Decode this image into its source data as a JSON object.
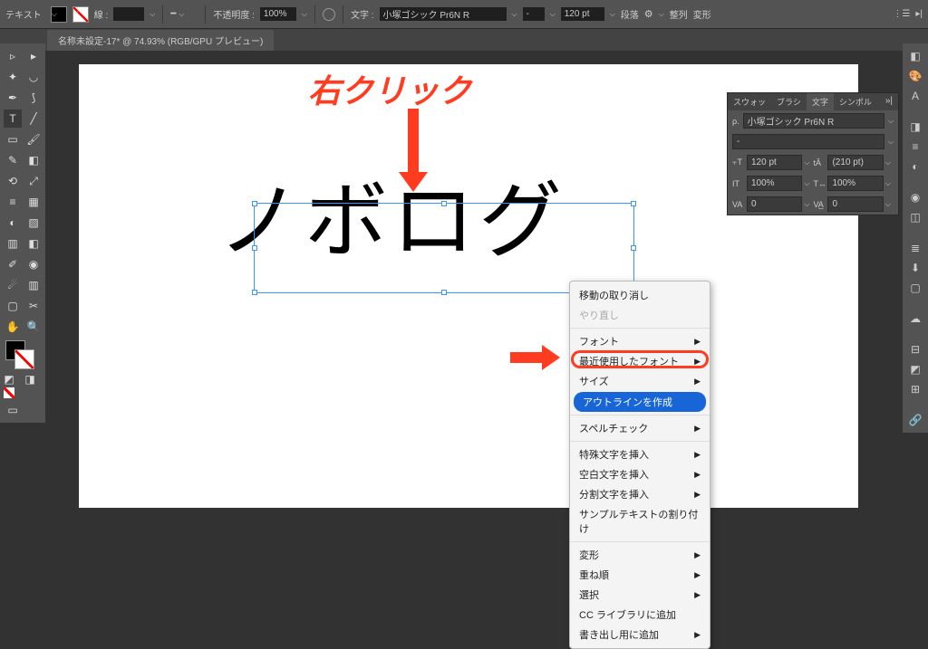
{
  "topbar": {
    "tool_label": "テキスト",
    "stroke_label": "線 :",
    "stroke_width": "",
    "opacity_label": "不透明度 :",
    "opacity_value": "100%",
    "char_label": "文字 :",
    "font_name": "小塚ゴシック Pr6N R",
    "font_style": "-",
    "font_size": "120 pt",
    "para_label": "段落",
    "align_label": "整列",
    "transform_label": "変形"
  },
  "document": {
    "tab_title": "名称未設定-17* @ 74.93% (RGB/GPU プレビュー)"
  },
  "canvas": {
    "text_content": "ノボログ"
  },
  "annotation": {
    "title": "右クリック"
  },
  "char_panel": {
    "tabs": [
      "スウォッ",
      "ブラシ",
      "文字",
      "シンボル"
    ],
    "font": "小塚ゴシック Pr6N R",
    "style": "-",
    "size": "120 pt",
    "leading": "(210 pt)",
    "hscale": "100%",
    "vscale": "100%",
    "tracking": "0",
    "kerning": "0"
  },
  "context_menu": {
    "items": [
      {
        "label": "移動の取り消し",
        "disabled": false,
        "sub": false
      },
      {
        "label": "やり直し",
        "disabled": true,
        "sub": false
      },
      {
        "sep": true
      },
      {
        "label": "フォント",
        "sub": true
      },
      {
        "label": "最近使用したフォント",
        "sub": true
      },
      {
        "label": "サイズ",
        "sub": true
      },
      {
        "label": "アウトラインを作成",
        "highlight": true
      },
      {
        "sep": true
      },
      {
        "label": "スペルチェック",
        "sub": true
      },
      {
        "sep": true
      },
      {
        "label": "特殊文字を挿入",
        "sub": true
      },
      {
        "label": "空白文字を挿入",
        "sub": true
      },
      {
        "label": "分割文字を挿入",
        "sub": true
      },
      {
        "label": "サンプルテキストの割り付け"
      },
      {
        "sep": true
      },
      {
        "label": "変形",
        "sub": true
      },
      {
        "label": "重ね順",
        "sub": true
      },
      {
        "label": "選択",
        "sub": true
      },
      {
        "label": "CC ライブラリに追加"
      },
      {
        "label": "書き出し用に追加",
        "sub": true
      }
    ]
  }
}
